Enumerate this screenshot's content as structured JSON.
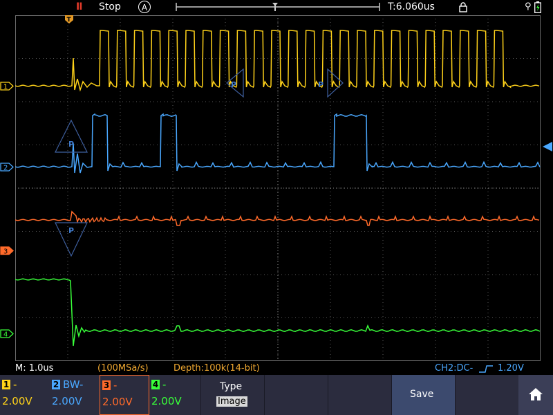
{
  "status": {
    "run_icon": "II",
    "run_state": "Stop",
    "trigger_mode_icon": "A",
    "time_offset": "T:6.060us"
  },
  "bottom_status": {
    "timebase": "M: 1.0us",
    "sample_rate": "(100MSa/s)",
    "depth": "Depth:100k(14-bit)",
    "trigger_info": "CH2:DC-",
    "trigger_level": "1.20V"
  },
  "channels": [
    {
      "num": "1",
      "coupling": "-",
      "vdiv": "2.00V",
      "color": "#ffd21a",
      "marker": "1",
      "wave": "pulse-train"
    },
    {
      "num": "2",
      "coupling": "BW-",
      "vdiv": "2.00V",
      "color": "#4aa8ff",
      "marker": "2",
      "wave": "bursts"
    },
    {
      "num": "3",
      "coupling": "-",
      "vdiv": "2.00V",
      "color": "#ff6a2a",
      "marker": "3",
      "wave": "flat-noisy"
    },
    {
      "num": "4",
      "coupling": "-",
      "vdiv": "2.00V",
      "color": "#39ff3a",
      "marker": "4",
      "wave": "falling-step"
    }
  ],
  "softkeys": {
    "type_label": "Type",
    "type_value": "Image",
    "save_label": "Save",
    "home_icon": "home-icon"
  },
  "trigger_marker": "T"
}
